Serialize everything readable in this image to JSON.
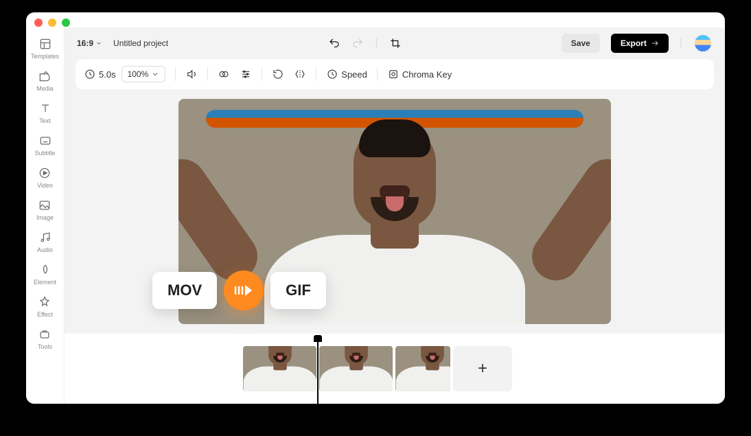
{
  "header": {
    "aspect_ratio": "16:9",
    "project_title": "Untitled project",
    "save_label": "Save",
    "export_label": "Export"
  },
  "sidebar": {
    "items": [
      {
        "label": "Templates",
        "icon": "templates-icon"
      },
      {
        "label": "Media",
        "icon": "media-icon"
      },
      {
        "label": "Text",
        "icon": "text-icon"
      },
      {
        "label": "Subtitle",
        "icon": "subtitle-icon"
      },
      {
        "label": "Video",
        "icon": "video-icon"
      },
      {
        "label": "Image",
        "icon": "image-icon"
      },
      {
        "label": "Audio",
        "icon": "audio-icon"
      },
      {
        "label": "Element",
        "icon": "element-icon"
      },
      {
        "label": "Effect",
        "icon": "effect-icon"
      },
      {
        "label": "Tools",
        "icon": "tools-icon"
      }
    ]
  },
  "toolbar": {
    "duration": "5.0s",
    "zoom": "100%",
    "speed_label": "Speed",
    "chroma_label": "Chroma Key"
  },
  "conversion": {
    "from": "MOV",
    "to": "GIF"
  },
  "timeline": {
    "clip_count": 3
  }
}
